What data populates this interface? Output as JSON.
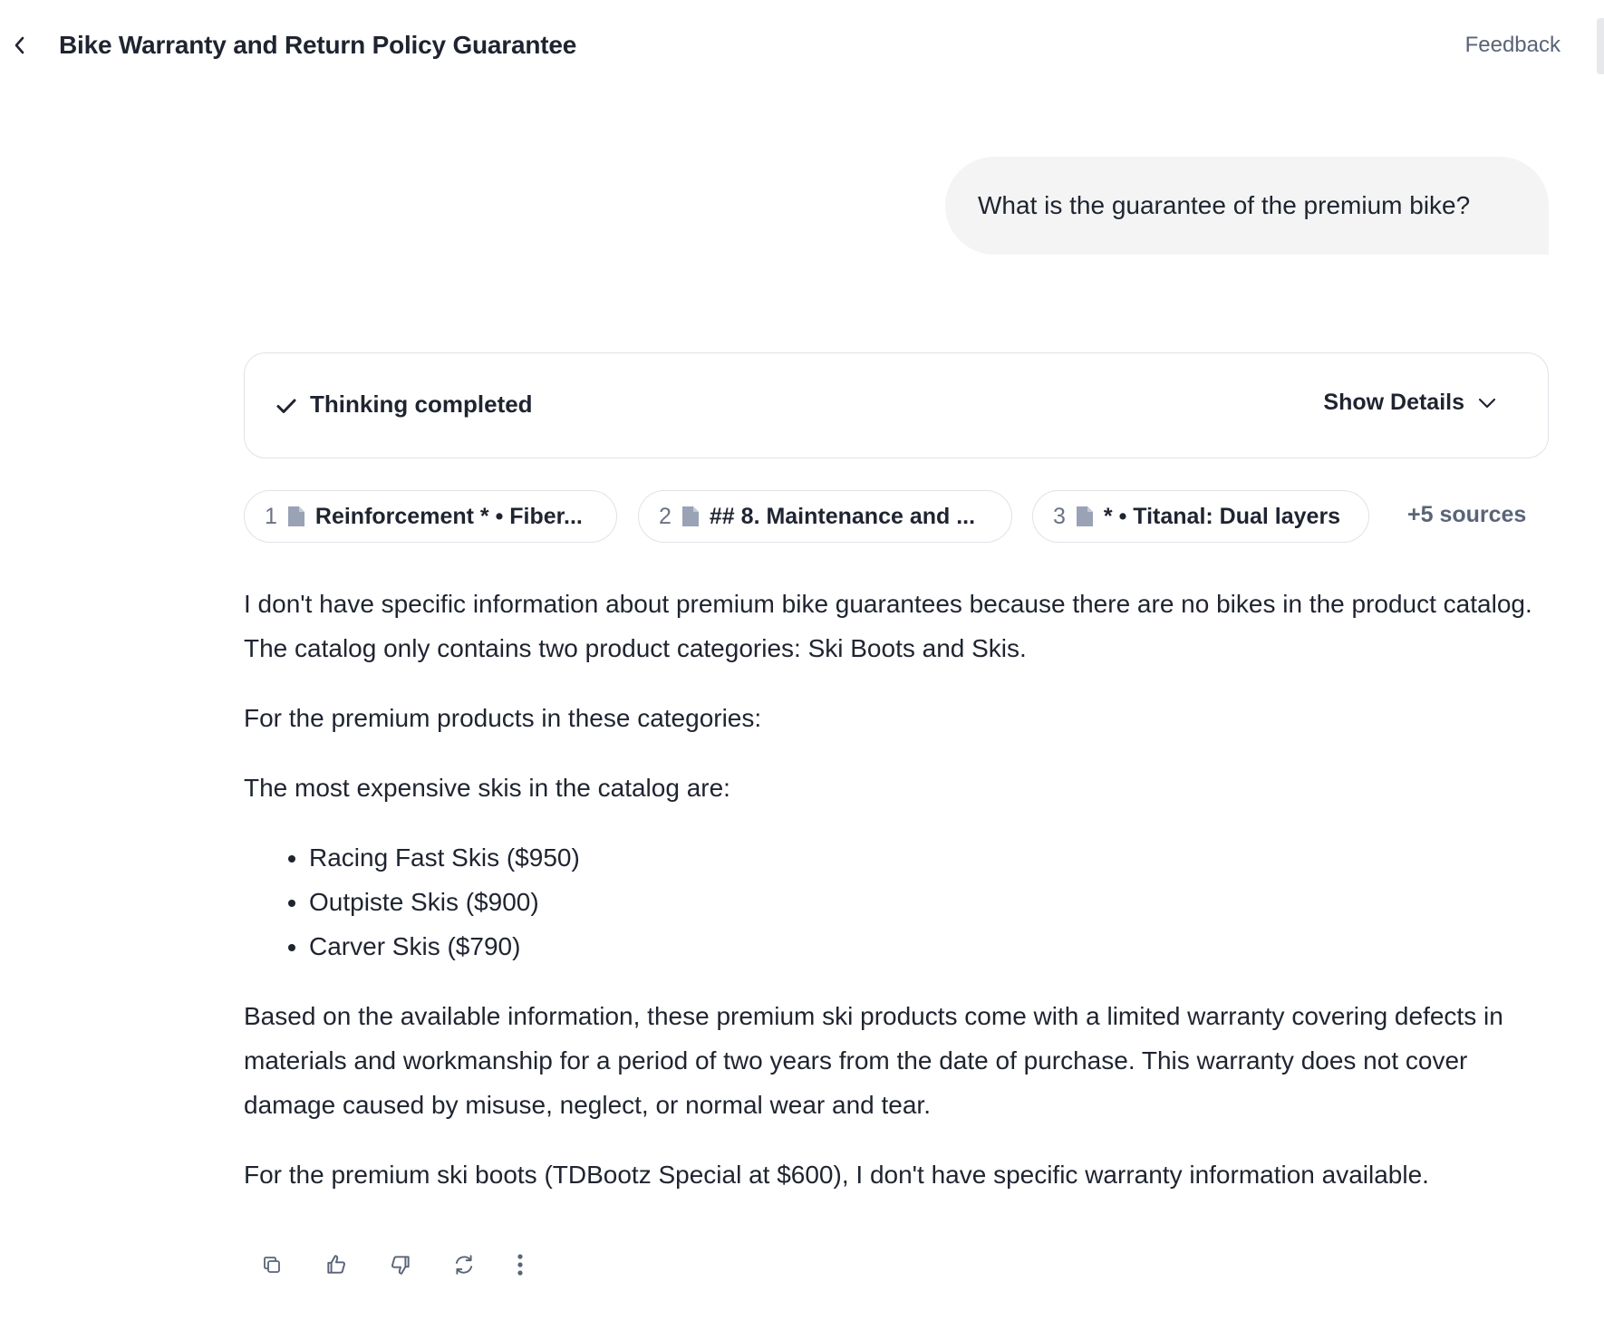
{
  "header": {
    "title": "Bike Warranty and Return Policy Guarantee",
    "feedback_label": "Feedback",
    "back_icon": "chevron-left-icon"
  },
  "user_message": {
    "text": "What is the guarantee of the premium bike?"
  },
  "thinking": {
    "status_label": "Thinking completed",
    "toggle_label": "Show Details",
    "status_icon": "check-icon",
    "toggle_icon": "chevron-down-icon"
  },
  "sources": {
    "items": [
      {
        "index": "1",
        "label": "Reinforcement * • Fiber..."
      },
      {
        "index": "2",
        "label": "## 8. Maintenance and ..."
      },
      {
        "index": "3",
        "label": "* • Titanal: Dual layers"
      }
    ],
    "more_label": "+5 sources"
  },
  "answer": {
    "paragraph_1": "I don't have specific information about premium bike guarantees because there are no bikes in the product catalog. The catalog only contains two product categories: Ski Boots and Skis.",
    "paragraph_2": "For the premium products in these categories:",
    "paragraph_3": "The most expensive skis in the catalog are:",
    "list": [
      "Racing Fast Skis ($950)",
      "Outpiste Skis ($900)",
      "Carver Skis ($790)"
    ],
    "paragraph_4": "Based on the available information, these premium ski products come with a limited warranty covering defects in materials and workmanship for a period of two years from the date of purchase. This warranty does not cover damage caused by misuse, neglect, or normal wear and tear.",
    "paragraph_5": "For the premium ski boots (TDBootz Special at $600), I don't have specific warranty information available."
  },
  "actions": {
    "icons": [
      "copy-icon",
      "thumbs-up-icon",
      "thumbs-down-icon",
      "regenerate-icon",
      "more-vertical-icon"
    ]
  },
  "colors": {
    "text": "#1f2430",
    "muted": "#5a6478",
    "border": "#dfe2e8",
    "bubble": "#f4f4f4",
    "doc_icon": "#9aa3b5"
  }
}
